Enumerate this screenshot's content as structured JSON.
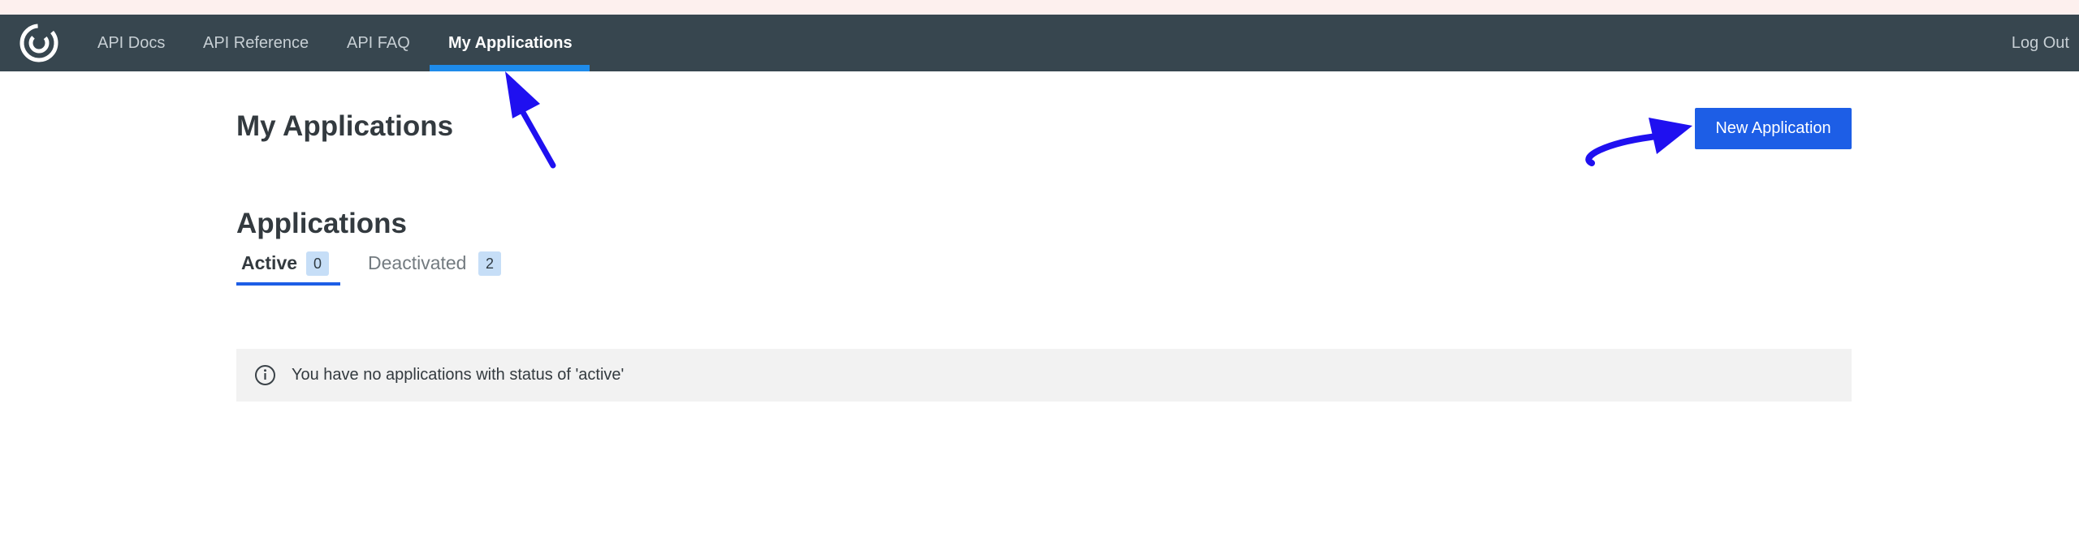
{
  "nav": {
    "items": [
      {
        "label": "API Docs"
      },
      {
        "label": "API Reference"
      },
      {
        "label": "API FAQ"
      },
      {
        "label": "My Applications"
      }
    ],
    "logout_label": "Log Out"
  },
  "page": {
    "title": "My Applications",
    "new_button_label": "New Application"
  },
  "applications": {
    "title": "Applications",
    "tabs": [
      {
        "label": "Active",
        "count": "0"
      },
      {
        "label": "Deactivated",
        "count": "2"
      }
    ],
    "empty_message": "You have no applications with status of 'active'"
  },
  "colors": {
    "navbar": "#37464f",
    "accent": "#1d5ee6",
    "annotation_arrow": "#1f10f0"
  }
}
